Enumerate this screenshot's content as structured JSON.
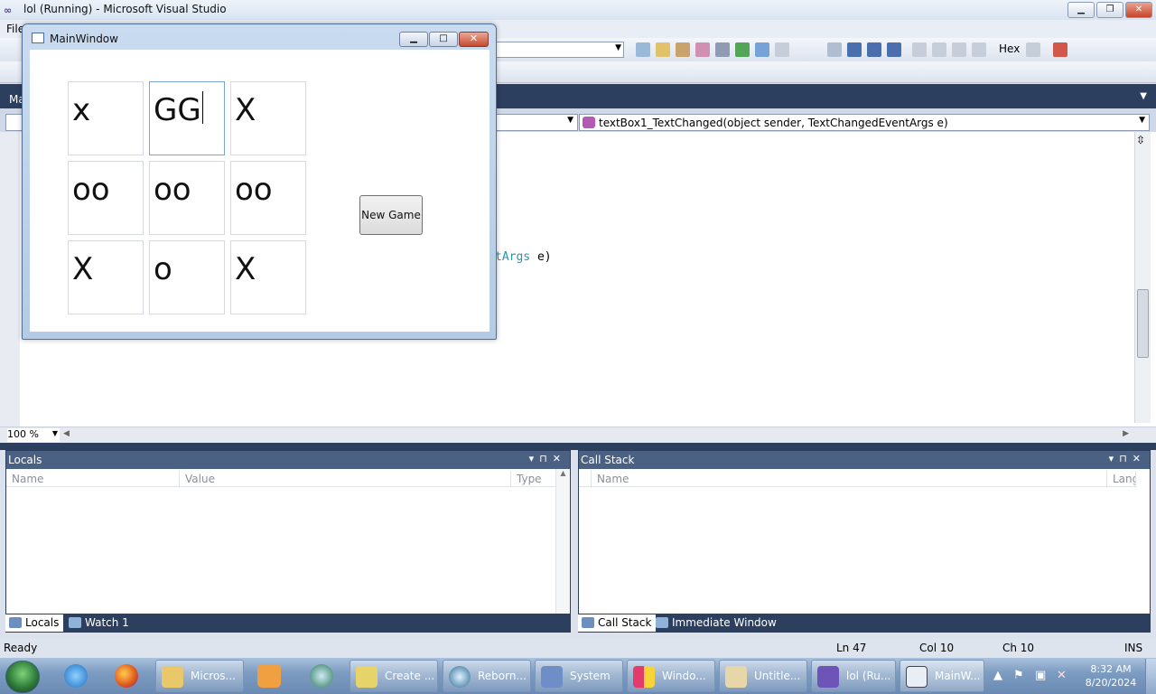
{
  "vs_window": {
    "title": "lol (Running) - Microsoft Visual Studio",
    "menu_first": "File",
    "toolbar_hex": "Hex",
    "editor_tab": "Ma",
    "nav_method": "textBox1_TextChanged(object sender, TextChangedEventArgs e)",
    "code_fragment_type": "tArgs",
    "code_fragment_rest": " e)",
    "zoom": "100 %"
  },
  "main_window": {
    "title": "MainWindow",
    "cells": [
      "x",
      "GG",
      "X",
      "oo",
      "oo",
      "oo",
      "X",
      "o",
      "X"
    ],
    "new_game_label": "New Game"
  },
  "locals_pane": {
    "title": "Locals",
    "columns": [
      "Name",
      "Value",
      "Type"
    ],
    "tabs": [
      "Locals",
      "Watch 1"
    ]
  },
  "callstack_pane": {
    "title": "Call Stack",
    "columns": [
      "Name",
      "Lang"
    ],
    "tabs": [
      "Call Stack",
      "Immediate Window"
    ]
  },
  "status_bar": {
    "state": "Ready",
    "line": "Ln 47",
    "col": "Col 10",
    "ch": "Ch 10",
    "mode": "INS"
  },
  "taskbar": {
    "buttons": [
      "Micros...",
      "Create ...",
      "Reborn...",
      "System",
      "Windo...",
      "Untitle...",
      "lol (Ru...",
      "MainW..."
    ],
    "time": "8:32 AM",
    "date": "8/20/2024"
  },
  "colors": {
    "vs_dark": "#2d3f5f",
    "pane_header": "#4a6184",
    "keyword_type": "#2b91af"
  }
}
